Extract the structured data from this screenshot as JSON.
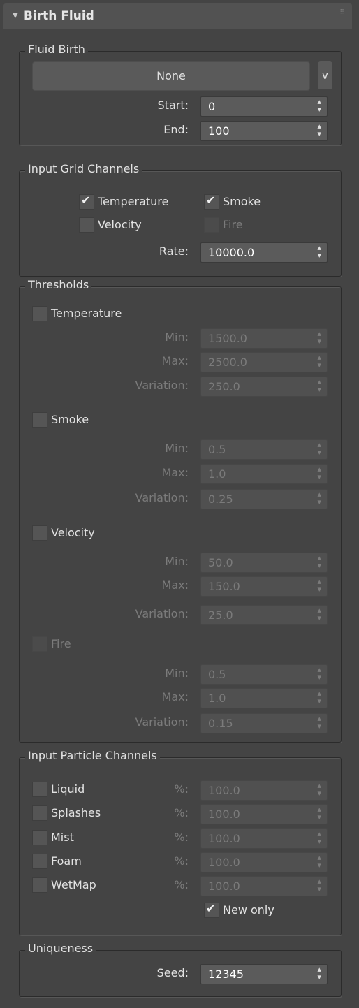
{
  "header": {
    "title": "Birth Fluid"
  },
  "fluid_birth": {
    "legend": "Fluid Birth",
    "source_button": "None",
    "dropdown_button": "v",
    "start": {
      "label": "Start:",
      "value": "0"
    },
    "end": {
      "label": "End:",
      "value": "100"
    }
  },
  "input_grid": {
    "legend": "Input Grid Channels",
    "temperature": {
      "label": "Temperature",
      "checked": true
    },
    "smoke": {
      "label": "Smoke",
      "checked": true
    },
    "velocity": {
      "label": "Velocity",
      "checked": false
    },
    "fire": {
      "label": "Fire",
      "checked": false,
      "disabled": true
    },
    "rate": {
      "label": "Rate:",
      "value": "10000.0"
    }
  },
  "thresholds": {
    "legend": "Thresholds",
    "temperature": {
      "label": "Temperature",
      "min": "1500.0",
      "max": "2500.0",
      "variation": "250.0"
    },
    "smoke": {
      "label": "Smoke",
      "min": "0.5",
      "max": "1.0",
      "variation": "0.25"
    },
    "velocity": {
      "label": "Velocity",
      "min": "50.0",
      "max": "150.0",
      "variation": "25.0"
    },
    "fire": {
      "label": "Fire",
      "min": "0.5",
      "max": "1.0",
      "variation": "0.15"
    },
    "labels": {
      "min": "Min:",
      "max": "Max:",
      "variation": "Variation:"
    }
  },
  "input_particle": {
    "legend": "Input Particle Channels",
    "pct_label": "%:",
    "channels": [
      {
        "label": "Liquid",
        "value": "100.0"
      },
      {
        "label": "Splashes",
        "value": "100.0"
      },
      {
        "label": "Mist",
        "value": "100.0"
      },
      {
        "label": "Foam",
        "value": "100.0"
      },
      {
        "label": "WetMap",
        "value": "100.0"
      }
    ],
    "new_only": {
      "label": "New only",
      "checked": true
    }
  },
  "uniqueness": {
    "legend": "Uniqueness",
    "seed": {
      "label": "Seed:",
      "value": "12345"
    }
  },
  "glyphs": {
    "check": "✔",
    "spinner": "▲▼",
    "collapse": "▼"
  }
}
